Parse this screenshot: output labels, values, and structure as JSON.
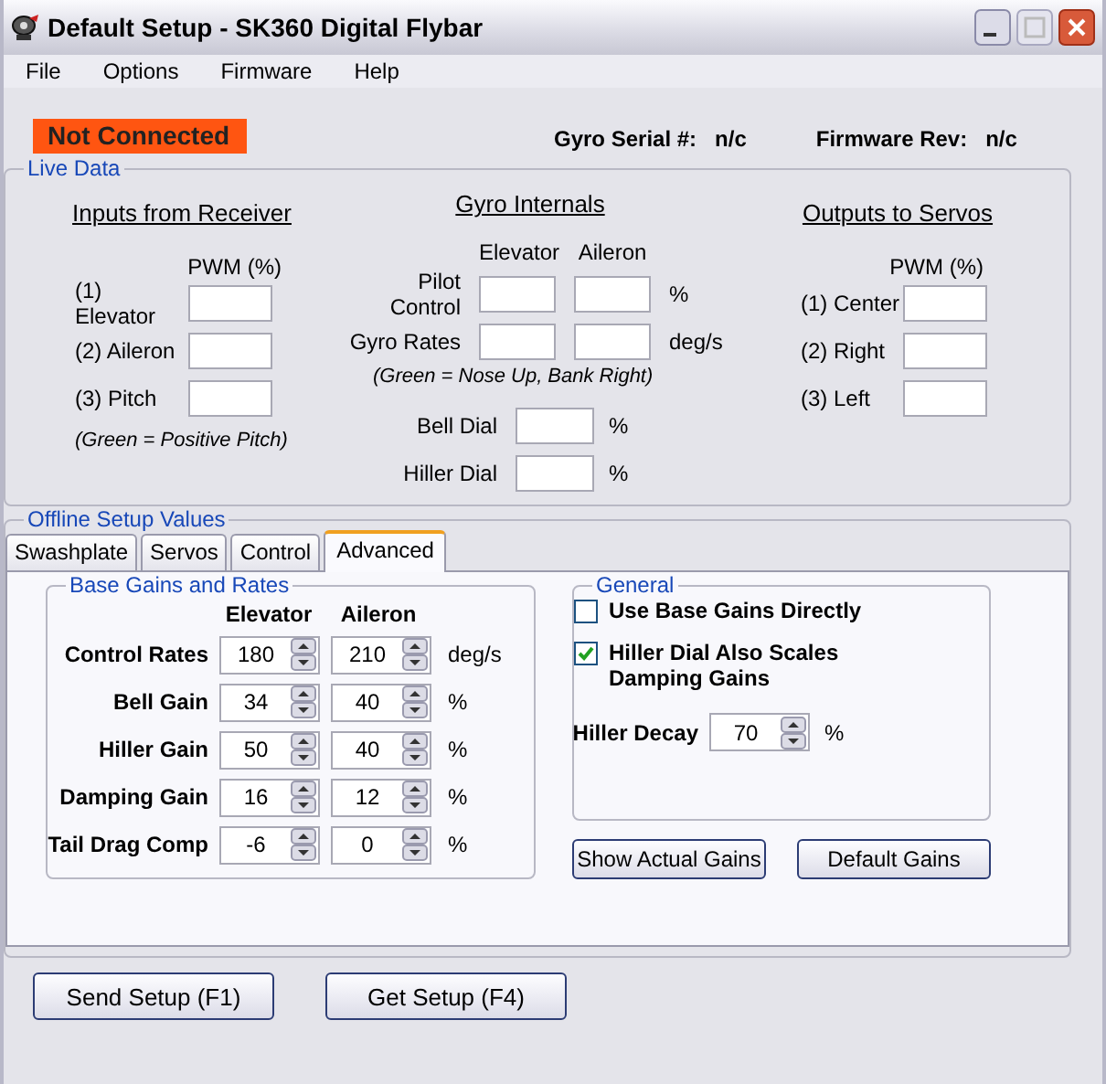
{
  "window": {
    "title": "Default Setup - SK360 Digital Flybar"
  },
  "menu": [
    "File",
    "Options",
    "Firmware",
    "Help"
  ],
  "status": {
    "connection": "Not Connected",
    "serial_label": "Gyro Serial #:",
    "serial": "n/c",
    "firmware_label": "Firmware Rev:",
    "firmware": "n/c"
  },
  "live_data": {
    "title": "Live Data",
    "inputs": {
      "heading": "Inputs from Receiver",
      "column": "PWM (%)",
      "rows": [
        {
          "label": "(1) Elevator"
        },
        {
          "label": "(2) Aileron"
        },
        {
          "label": "(3) Pitch"
        }
      ],
      "note": "(Green = Positive Pitch)"
    },
    "gyro": {
      "heading": "Gyro Internals",
      "columns": [
        "Elevator",
        "Aileron"
      ],
      "rows": [
        {
          "label": "Pilot Control",
          "unit": "%"
        },
        {
          "label": "Gyro Rates",
          "unit": "deg/s"
        }
      ],
      "note": "(Green = Nose Up, Bank Right)",
      "dials": [
        {
          "label": "Bell Dial",
          "unit": "%"
        },
        {
          "label": "Hiller Dial",
          "unit": "%"
        }
      ]
    },
    "outputs": {
      "heading": "Outputs to Servos",
      "column": "PWM (%)",
      "rows": [
        {
          "label": "(1) Center"
        },
        {
          "label": "(2) Right"
        },
        {
          "label": "(3) Left"
        }
      ]
    }
  },
  "offline": {
    "title": "Offline Setup Values",
    "tabs": [
      {
        "label": "Swashplate",
        "selected": false
      },
      {
        "label": "Servos",
        "selected": false
      },
      {
        "label": "Control",
        "selected": false
      },
      {
        "label": "Advanced",
        "selected": true
      }
    ],
    "base": {
      "title": "Base Gains and Rates",
      "columns": [
        "Elevator",
        "Aileron"
      ],
      "rows": [
        {
          "label": "Control Rates",
          "values": [
            "180",
            "210"
          ],
          "unit": "deg/s"
        },
        {
          "label": "Bell Gain",
          "values": [
            "34",
            "40"
          ],
          "unit": "%"
        },
        {
          "label": "Hiller Gain",
          "values": [
            "50",
            "40"
          ],
          "unit": "%"
        },
        {
          "label": "Damping Gain",
          "values": [
            "16",
            "12"
          ],
          "unit": "%"
        },
        {
          "label": "Tail Drag Comp",
          "values": [
            "-6",
            "0"
          ],
          "unit": "%"
        }
      ]
    },
    "general": {
      "title": "General",
      "options": [
        {
          "label": "Use Base Gains Directly",
          "checked": false
        },
        {
          "label": "Hiller Dial Also Scales Damping Gains",
          "checked": true
        }
      ],
      "decay": {
        "label": "Hiller Decay",
        "value": "70",
        "unit": "%"
      }
    },
    "buttons": [
      "Show Actual Gains",
      "Default Gains"
    ]
  },
  "buttons": [
    "Send Setup (F1)",
    "Get Setup (F4)"
  ]
}
